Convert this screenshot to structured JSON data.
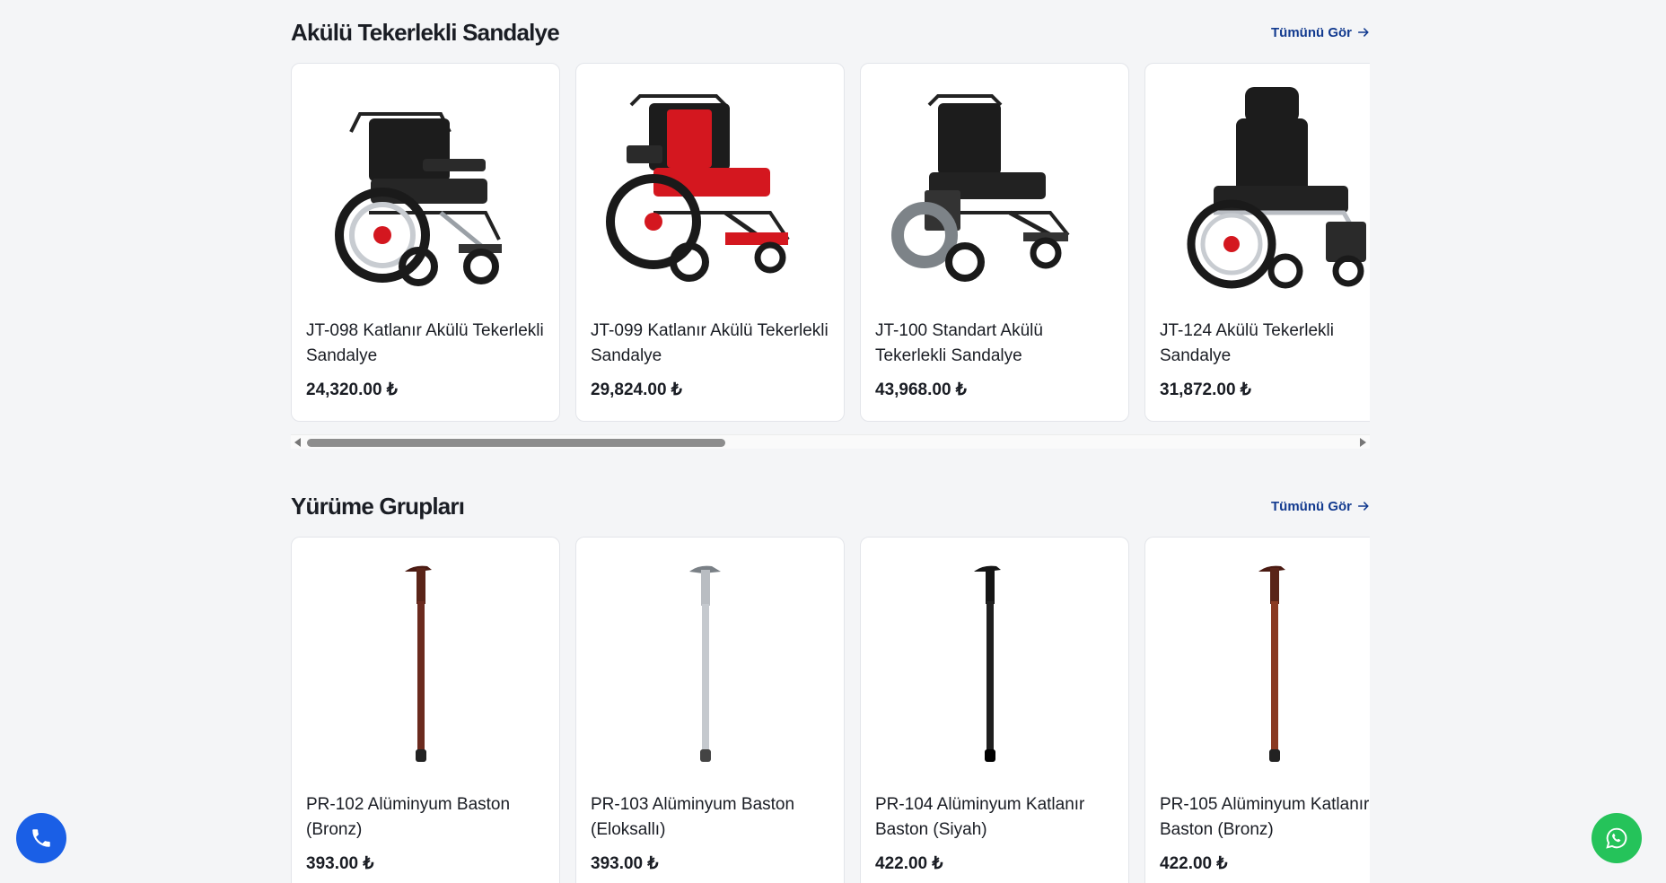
{
  "sections": [
    {
      "title": "Akülü Tekerlekli Sandalye",
      "see_all": "Tümünü Gör",
      "products": [
        {
          "name": "JT-098 Katlanır Akülü Tekerlekli Sandalye",
          "price": "24,320.00 ₺"
        },
        {
          "name": "JT-099 Katlanır Akülü Tekerlekli Sandalye",
          "price": "29,824.00 ₺"
        },
        {
          "name": "JT-100 Standart Akülü Tekerlekli Sandalye",
          "price": "43,968.00 ₺"
        },
        {
          "name": "JT-124 Akülü Tekerlekli Sandalye",
          "price": "31,872.00 ₺"
        }
      ],
      "scroll_position": 0.4
    },
    {
      "title": "Yürüme Grupları",
      "see_all": "Tümünü Gör",
      "products": [
        {
          "name": "PR-102 Alüminyum Baston (Bronz)",
          "price": "393.00 ₺"
        },
        {
          "name": "PR-103 Alüminyum Baston (Eloksallı)",
          "price": "393.00 ₺"
        },
        {
          "name": "PR-104 Alüminyum Katlanır Baston (Siyah)",
          "price": "422.00 ₺"
        },
        {
          "name": "PR-105 Alüminyum Katlanır Baston (Bronz)",
          "price": "422.00 ₺"
        }
      ]
    }
  ],
  "colors": {
    "link": "#123a8f",
    "phone_button": "#1a5fe6",
    "whatsapp_button": "#25c35a",
    "chair_red_accent": "#d4171f",
    "cane_bronze": "#6b2a1e",
    "cane_silver": "#b9bdc2",
    "cane_black": "#151515"
  },
  "icons": {
    "see_all": "arrow-right-icon",
    "phone": "phone-icon",
    "whatsapp": "whatsapp-icon"
  }
}
